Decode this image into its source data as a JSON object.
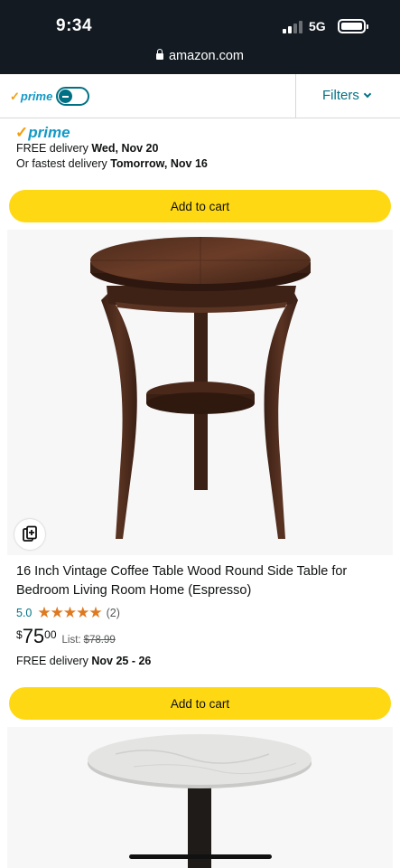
{
  "status_bar": {
    "time": "9:34",
    "network": "5G",
    "signal_bars_active": 2,
    "signal_bars_total": 4,
    "battery_icon": "battery-full-icon"
  },
  "browser": {
    "url": "amazon.com",
    "lock_icon": "lock-icon"
  },
  "filter_bar": {
    "prime_label": "prime",
    "prime_toggle_on": true,
    "filters_label": "Filters"
  },
  "prev_product": {
    "prime_badge": "prime",
    "delivery_prefix": "FREE delivery ",
    "delivery_date": "Wed, Nov 20",
    "fastest_prefix": "Or fastest delivery ",
    "fastest_date": "Tomorrow, Nov 16",
    "add_to_cart": "Add to cart"
  },
  "product": {
    "title": "16 Inch Vintage Coffee Table Wood Round Side Table for Bedroom Living Room Home (Espresso)",
    "rating": "5.0",
    "stars_display": "★★★★★",
    "rating_count": "(2)",
    "price_symbol": "$",
    "price_whole": "75",
    "price_fraction": "00",
    "list_label": "List:",
    "list_price": "$78.99",
    "delivery_prefix": "FREE delivery ",
    "delivery_date": "Nov 25 - 26",
    "add_to_cart": "Add to cart",
    "compare_icon": "compare-icon"
  },
  "colors": {
    "header_bg": "#131a22",
    "accent_link": "#007185",
    "prime_blue": "#1399c6",
    "star_orange": "#de7921",
    "cart_button": "#ffd814"
  }
}
